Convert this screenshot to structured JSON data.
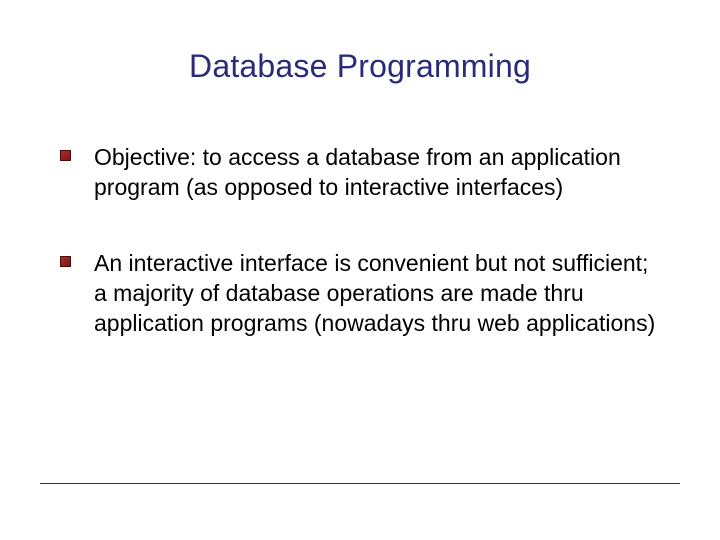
{
  "title": "Database Programming",
  "bullets": [
    "Objective: to access a database from an application program (as opposed to interactive interfaces)",
    "An interactive interface is convenient but not sufficient; a majority of database operations are made thru application programs (nowadays thru web applications)"
  ]
}
